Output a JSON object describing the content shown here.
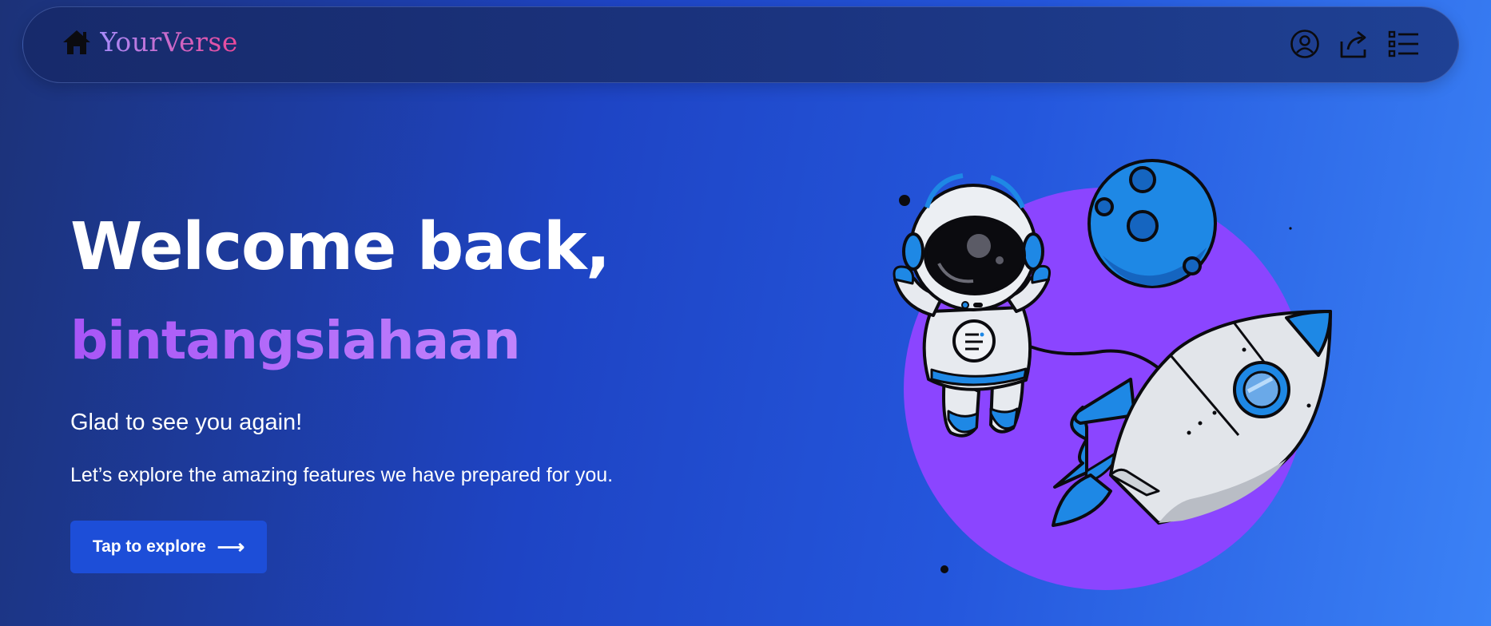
{
  "navbar": {
    "brand": "YourVerse",
    "icons": [
      "home-icon",
      "user-circle-icon",
      "share-icon",
      "list-icon"
    ]
  },
  "hero": {
    "title": "Welcome back,",
    "username": "bintangsiahaan",
    "greeting": "Glad to see you again!",
    "subtext": "Let’s explore the amazing features we have prepared for you.",
    "cta_label": "Tap to explore",
    "cta_arrow": "⟶"
  },
  "colors": {
    "accent_button": "#1d4ed8",
    "brand_gradient_start": "#a78bfa",
    "brand_gradient_end": "#ec4899",
    "username_color": "#a855f7",
    "planet_purple": "#8b45ff",
    "rocket_blue": "#1e88e5"
  },
  "illustration": {
    "subject": "astronaut-rocket-moon-illustration"
  }
}
